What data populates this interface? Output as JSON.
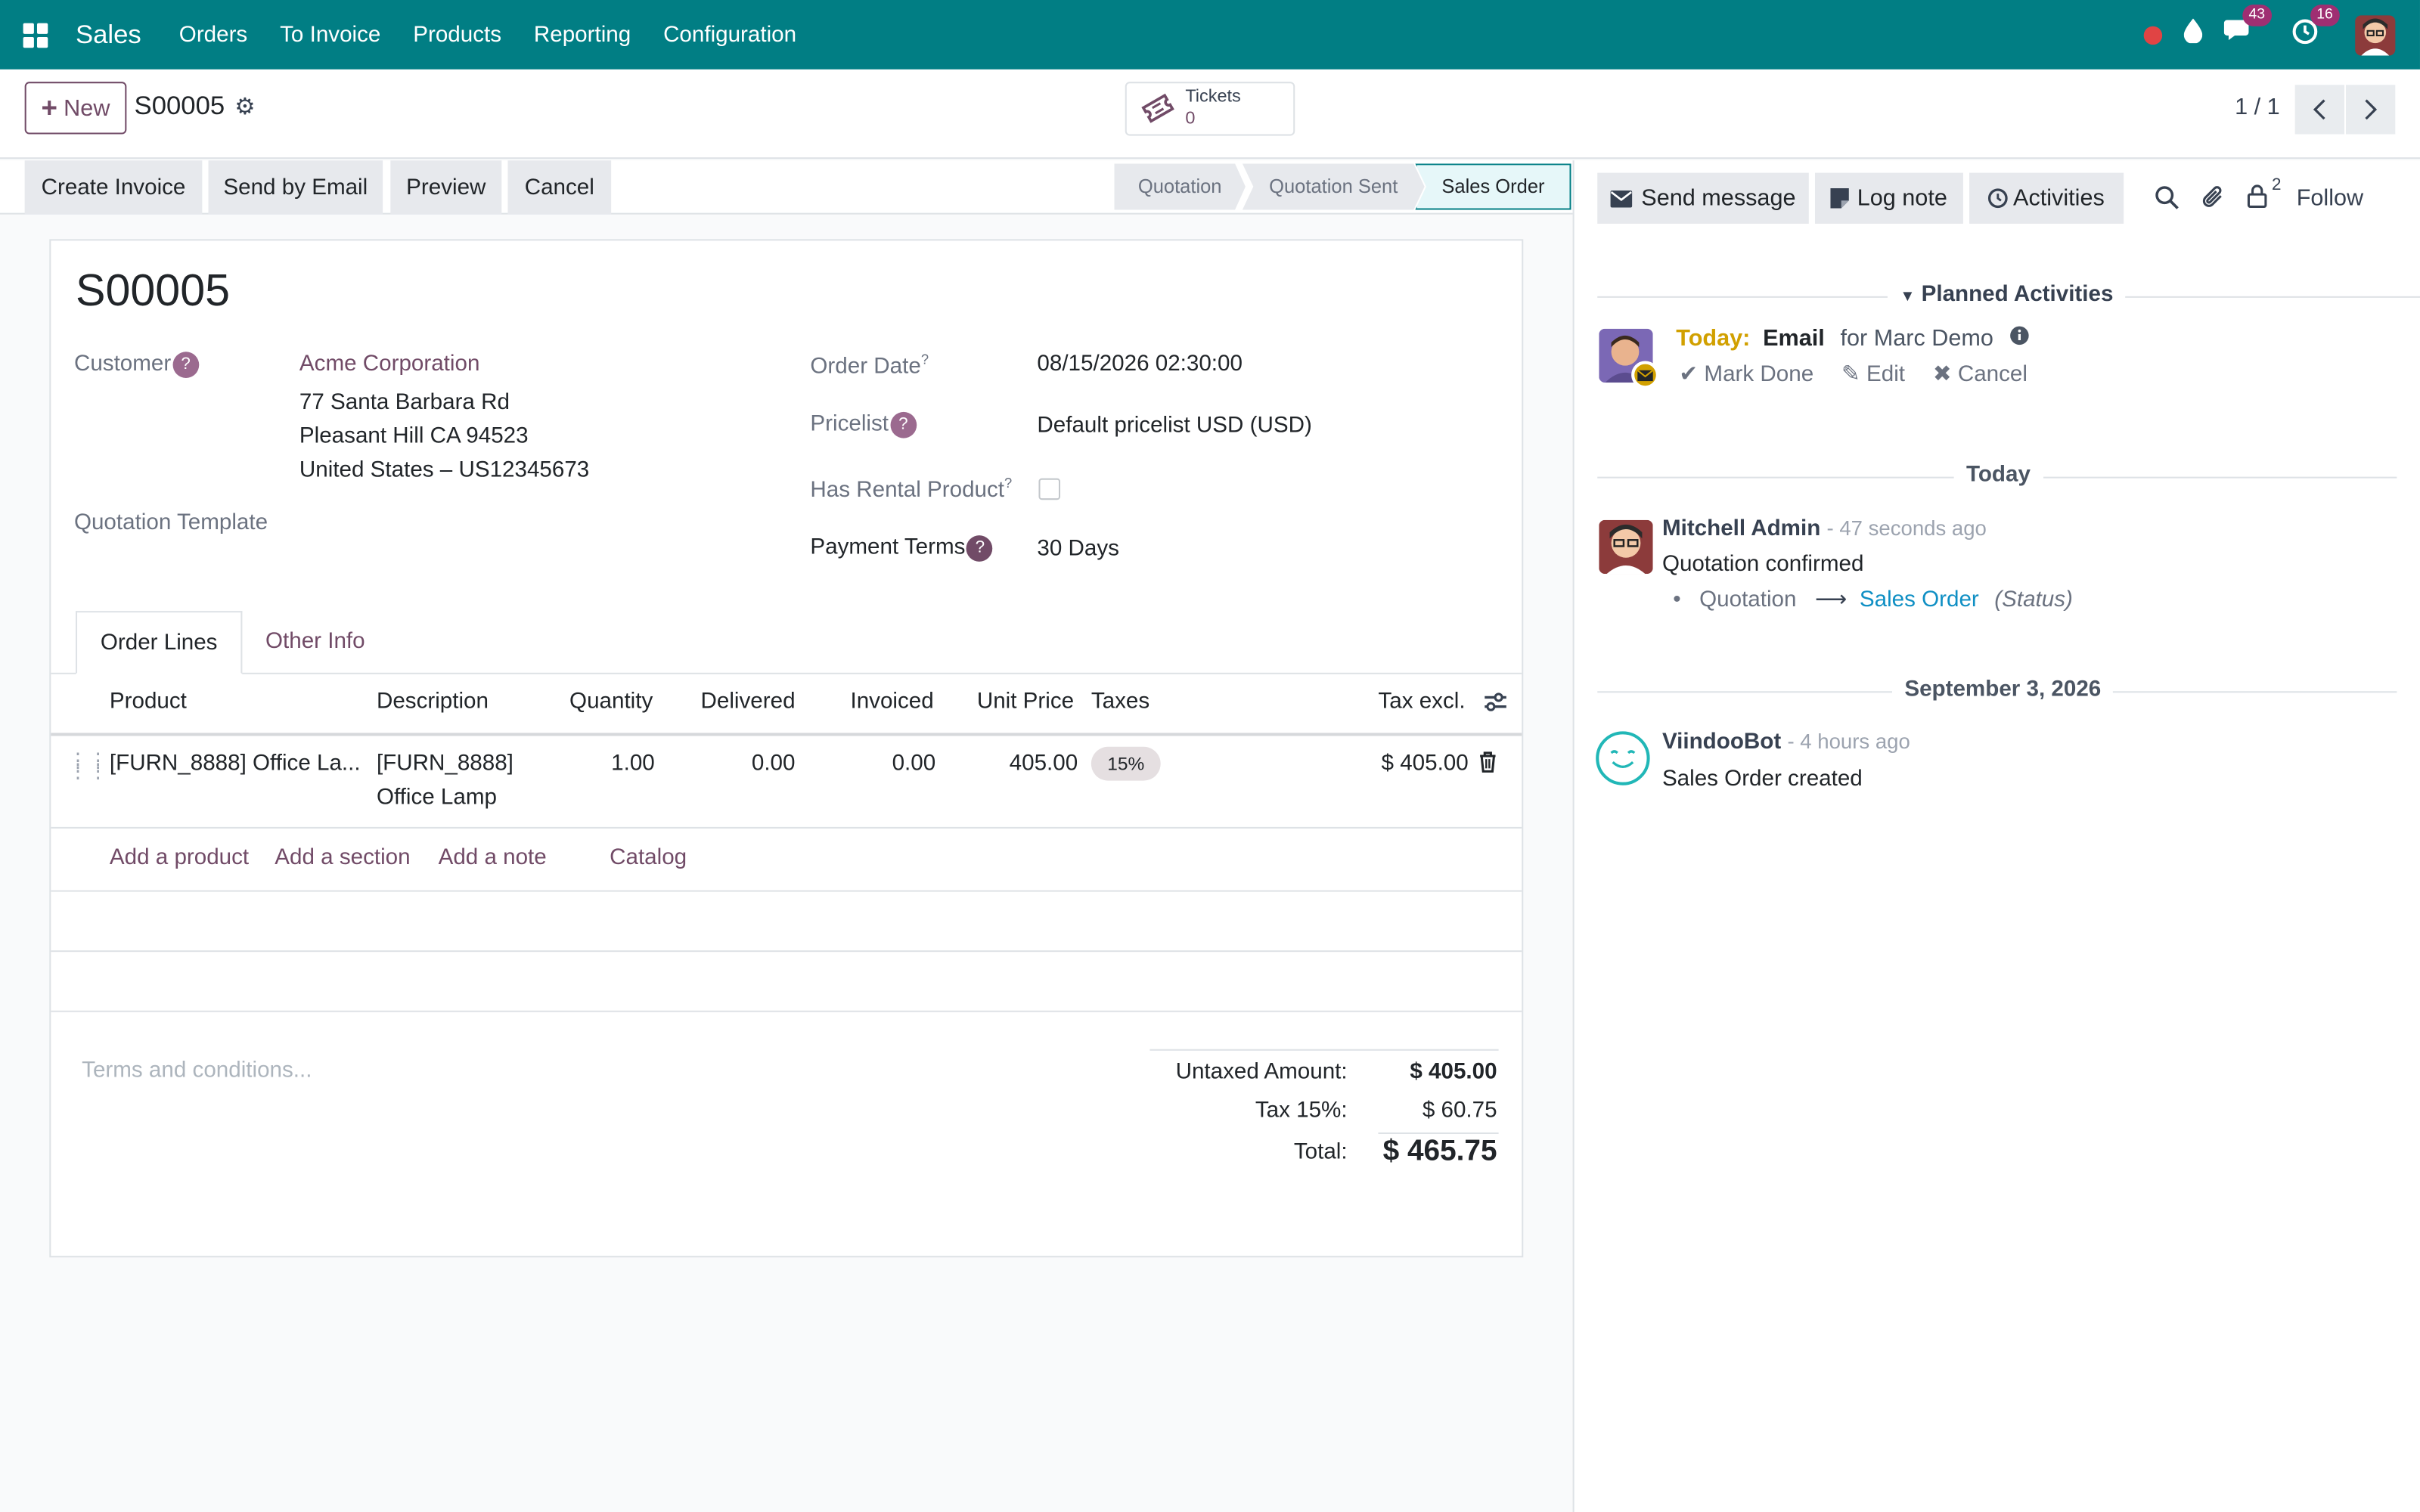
{
  "navbar": {
    "brand": "Sales",
    "menu": [
      "Orders",
      "To Invoice",
      "Products",
      "Reporting",
      "Configuration"
    ],
    "messages_count": "43",
    "activities_count": "16"
  },
  "control": {
    "new_label": "New",
    "record_name": "S00005",
    "tickets_label": "Tickets",
    "tickets_count": "0",
    "pager": "1 / 1"
  },
  "actions": {
    "create_invoice": "Create Invoice",
    "send_email": "Send by Email",
    "preview": "Preview",
    "cancel": "Cancel"
  },
  "statusbar": {
    "steps": [
      "Quotation",
      "Quotation Sent",
      "Sales Order"
    ],
    "active": "Sales Order"
  },
  "form": {
    "title": "S00005",
    "customer_label": "Customer",
    "customer_name": "Acme Corporation",
    "address_line1": "77 Santa Barbara Rd",
    "address_line2": "Pleasant Hill CA 94523",
    "address_line3": "United States – US12345673",
    "quotation_template_label": "Quotation Template",
    "order_date_label": "Order Date",
    "order_date": "08/15/2026 02:30:00",
    "pricelist_label": "Pricelist",
    "pricelist": "Default pricelist USD (USD)",
    "rental_label": "Has Rental Product",
    "payment_terms_label": "Payment Terms",
    "payment_terms": "30 Days"
  },
  "tabs": {
    "order_lines": "Order Lines",
    "other_info": "Other Info"
  },
  "table": {
    "headers": [
      "Product",
      "Description",
      "Quantity",
      "Delivered",
      "Invoiced",
      "Unit Price",
      "Taxes",
      "Tax excl."
    ],
    "rows": [
      {
        "product": "[FURN_8888] Office La...",
        "description_line1": "[FURN_8888]",
        "description_line2": "Office Lamp",
        "quantity": "1.00",
        "delivered": "0.00",
        "invoiced": "0.00",
        "unit_price": "405.00",
        "taxes": "15%",
        "subtotal": "$ 405.00"
      }
    ],
    "add_product": "Add a product",
    "add_section": "Add a section",
    "add_note": "Add a note",
    "catalog": "Catalog"
  },
  "footer": {
    "terms_placeholder": "Terms and conditions...",
    "untaxed_label": "Untaxed Amount:",
    "untaxed_value": "$ 405.00",
    "tax_label": "Tax 15%:",
    "tax_value": "$ 60.75",
    "total_label": "Total:",
    "total_value": "$ 465.75"
  },
  "chatter": {
    "send_message": "Send message",
    "log_note": "Log note",
    "activities": "Activities",
    "followers_count": "2",
    "follow": "Follow",
    "planned_header": "Planned Activities",
    "activity_today": "Today:",
    "activity_type": "Email",
    "activity_for": "for Marc Demo",
    "mark_done": "Mark Done",
    "edit": "Edit",
    "cancel": "Cancel",
    "sep_today": "Today",
    "msg1_author": "Mitchell Admin",
    "msg1_time": "- 47 seconds ago",
    "msg1_text": "Quotation confirmed",
    "msg1_old": "Quotation",
    "msg1_new": "Sales Order",
    "msg1_field": "(Status)",
    "sep_date": "September 3, 2026",
    "msg2_author": "ViindooBot",
    "msg2_time": "- 4 hours ago",
    "msg2_text": "Sales Order created"
  },
  "colors": {
    "navbar": "#017e84",
    "primary": "#714b67",
    "link_blue": "#0f8fc4",
    "today_orange": "#d1a000"
  }
}
